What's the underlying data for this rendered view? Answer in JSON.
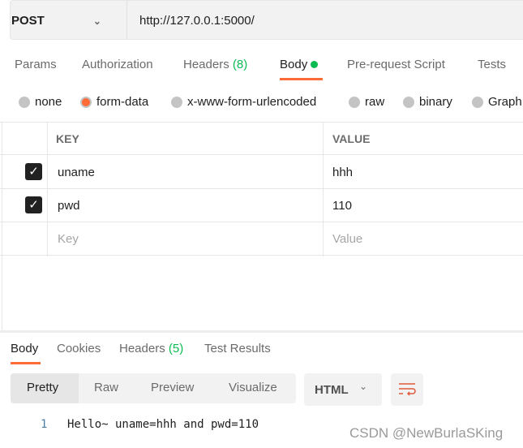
{
  "request": {
    "method": "POST",
    "url": "http://127.0.0.1:5000/"
  },
  "tabs": [
    {
      "label": "Params"
    },
    {
      "label": "Authorization"
    },
    {
      "label": "Headers",
      "count": "(8)"
    },
    {
      "label": "Body"
    },
    {
      "label": "Pre-request Script"
    },
    {
      "label": "Tests"
    }
  ],
  "body_types": [
    "none",
    "form-data",
    "x-www-form-urlencoded",
    "raw",
    "binary",
    "Graph"
  ],
  "selected_body_type": "form-data",
  "table": {
    "headers": [
      "KEY",
      "VALUE"
    ],
    "rows": [
      {
        "key": "uname",
        "value": "hhh",
        "checked": true
      },
      {
        "key": "pwd",
        "value": "110",
        "checked": true
      }
    ],
    "placeholder_key": "Key",
    "placeholder_value": "Value"
  },
  "response": {
    "tabs": [
      {
        "label": "Body"
      },
      {
        "label": "Cookies"
      },
      {
        "label": "Headers",
        "count": "(5)"
      },
      {
        "label": "Test Results"
      }
    ],
    "views": [
      "Pretty",
      "Raw",
      "Preview",
      "Visualize"
    ],
    "format": "HTML",
    "line_number": "1",
    "content": "Hello~ uname=hhh and pwd=110"
  },
  "watermark": "CSDN @NewBurlaSKing",
  "colors": {
    "accent": "#ff6c37",
    "green": "#0cbb52"
  }
}
